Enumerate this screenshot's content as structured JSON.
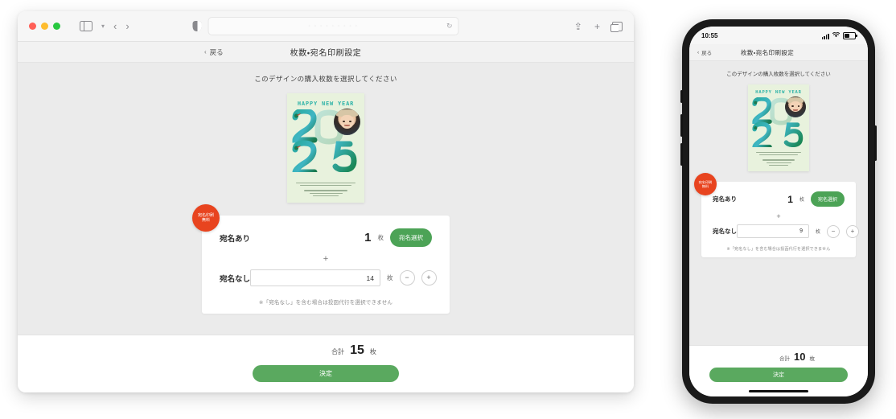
{
  "browser": {
    "traffic_lights": [
      "close",
      "minimize",
      "zoom"
    ],
    "sidebar_icon": "sidebar-icon",
    "back_icon": "‹",
    "forward_icon": "›",
    "shield_icon": "privacy-shield-icon",
    "url_text": "· ·   ·    · ·   · ·      · ·",
    "reload_icon": "↻",
    "share_icon": "⇪",
    "newtab_icon": "+",
    "tabs_icon": "tab-overview-icon"
  },
  "page": {
    "back_label": "戻る",
    "title": "枚数・宛名印刷設定",
    "subtitle": "このデザインの購入枚数を選択してください"
  },
  "postcard": {
    "greeting": "HAPPY NEW YEAR",
    "year": "2025",
    "photo_alt": "child-photo",
    "bg_color": "#e8f2dd",
    "accent_color": "#2fb3a8"
  },
  "select_card": {
    "badge_line1": "宛名印刷",
    "badge_line2": "無料",
    "badge_color": "#e8441f",
    "with_address": {
      "label": "宛名あり",
      "qty": "1",
      "unit": "枚",
      "button_label": "宛名選択"
    },
    "plus_symbol": "+",
    "without_address": {
      "label": "宛名なし",
      "qty_desktop": "14",
      "qty_mobile": "9",
      "unit": "枚",
      "minus_label": "−",
      "plus_label": "+"
    },
    "note": "※「宛名なし」を含む場合は投函代行を選択できません"
  },
  "footer": {
    "total_label": "合計",
    "total_desktop": "15",
    "total_mobile": "10",
    "unit": "枚",
    "submit_label": "決定",
    "submit_color": "#5aa95f"
  },
  "phone": {
    "status_time": "10:55",
    "signal_icon": "cellular-signal-icon",
    "wifi_icon": "▰",
    "battery_icon": "battery-icon"
  }
}
